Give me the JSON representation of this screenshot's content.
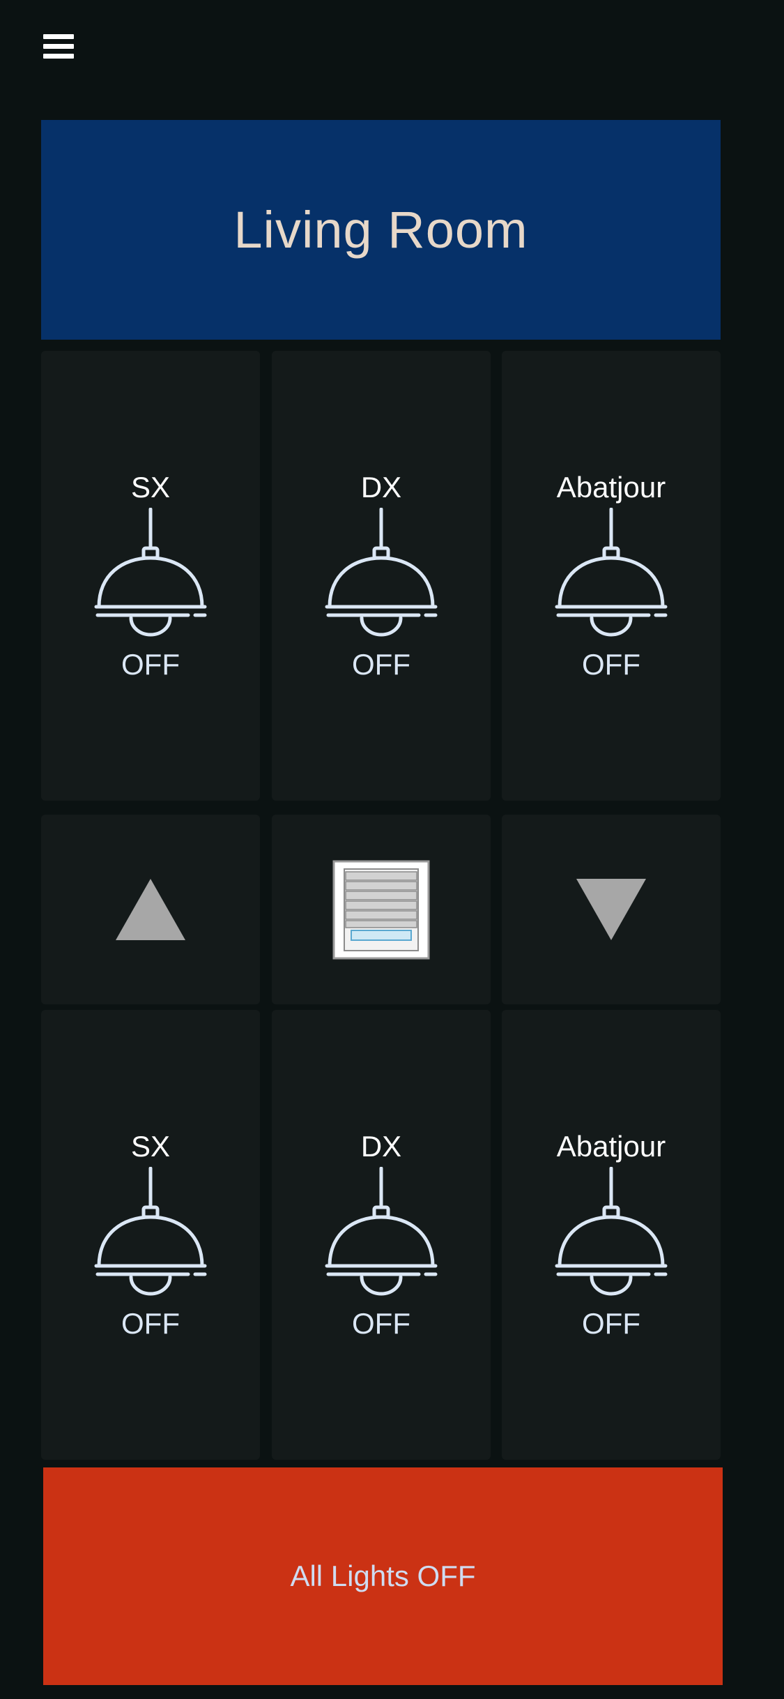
{
  "header": {
    "menu_icon": "hamburger-menu-icon",
    "title": "Living Room"
  },
  "lights_top": [
    {
      "name": "SX",
      "state": "OFF",
      "icon": "pendant-lamp-icon"
    },
    {
      "name": "DX",
      "state": "OFF",
      "icon": "pendant-lamp-icon"
    },
    {
      "name": "Abatjour",
      "state": "OFF",
      "icon": "pendant-lamp-icon"
    }
  ],
  "blinds": {
    "up_icon": "triangle-up-icon",
    "center_icon": "window-blind-icon",
    "down_icon": "triangle-down-icon"
  },
  "lights_bottom": [
    {
      "name": "SX",
      "state": "OFF",
      "icon": "pendant-lamp-icon"
    },
    {
      "name": "DX",
      "state": "OFF",
      "icon": "pendant-lamp-icon"
    },
    {
      "name": "Abatjour",
      "state": "OFF",
      "icon": "pendant-lamp-icon"
    }
  ],
  "footer": {
    "all_off_label": "All Lights OFF"
  },
  "colors": {
    "background": "#0b1212",
    "tile": "#141a1a",
    "header": "#063169",
    "all_off": "#cb3214",
    "lamp_stroke": "#dbe7f5",
    "arrow": "#a7a7a7"
  }
}
